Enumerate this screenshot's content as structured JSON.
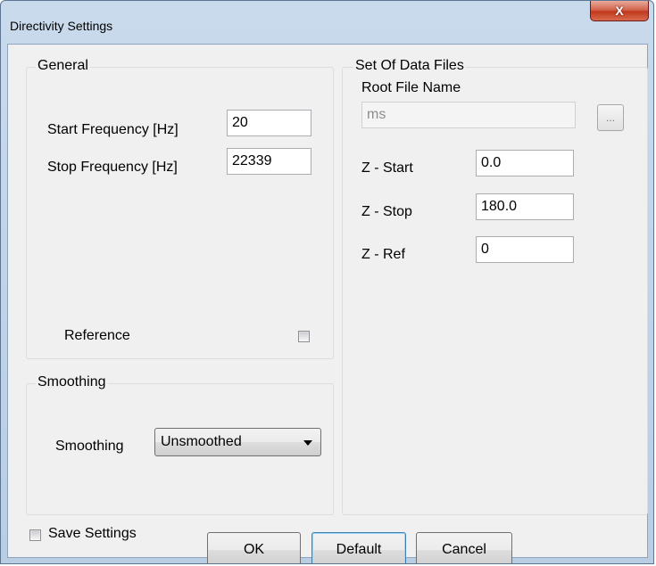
{
  "window": {
    "title": "Directivity Settings",
    "close_glyph": "X"
  },
  "general": {
    "legend": "General",
    "start_label": "Start Frequency [Hz]",
    "start_value": "20",
    "stop_label": "Stop Frequency [Hz]",
    "stop_value": "22339",
    "reference_label": "Reference",
    "reference_checked": false
  },
  "smoothing": {
    "legend": "Smoothing",
    "label": "Smoothing",
    "selected": "Unsmoothed"
  },
  "data_files": {
    "legend": "Set Of Data Files",
    "root_label": "Root File Name",
    "root_value": "ms",
    "browse_label": "...",
    "z_start_label": "Z - Start",
    "z_start_value": "0.0",
    "z_stop_label": "Z - Stop",
    "z_stop_value": "180.0",
    "z_ref_label": "Z - Ref",
    "z_ref_value": "0"
  },
  "footer": {
    "save_label": "Save Settings",
    "save_checked": false,
    "ok_label": "OK",
    "default_label": "Default",
    "cancel_label": "Cancel"
  }
}
